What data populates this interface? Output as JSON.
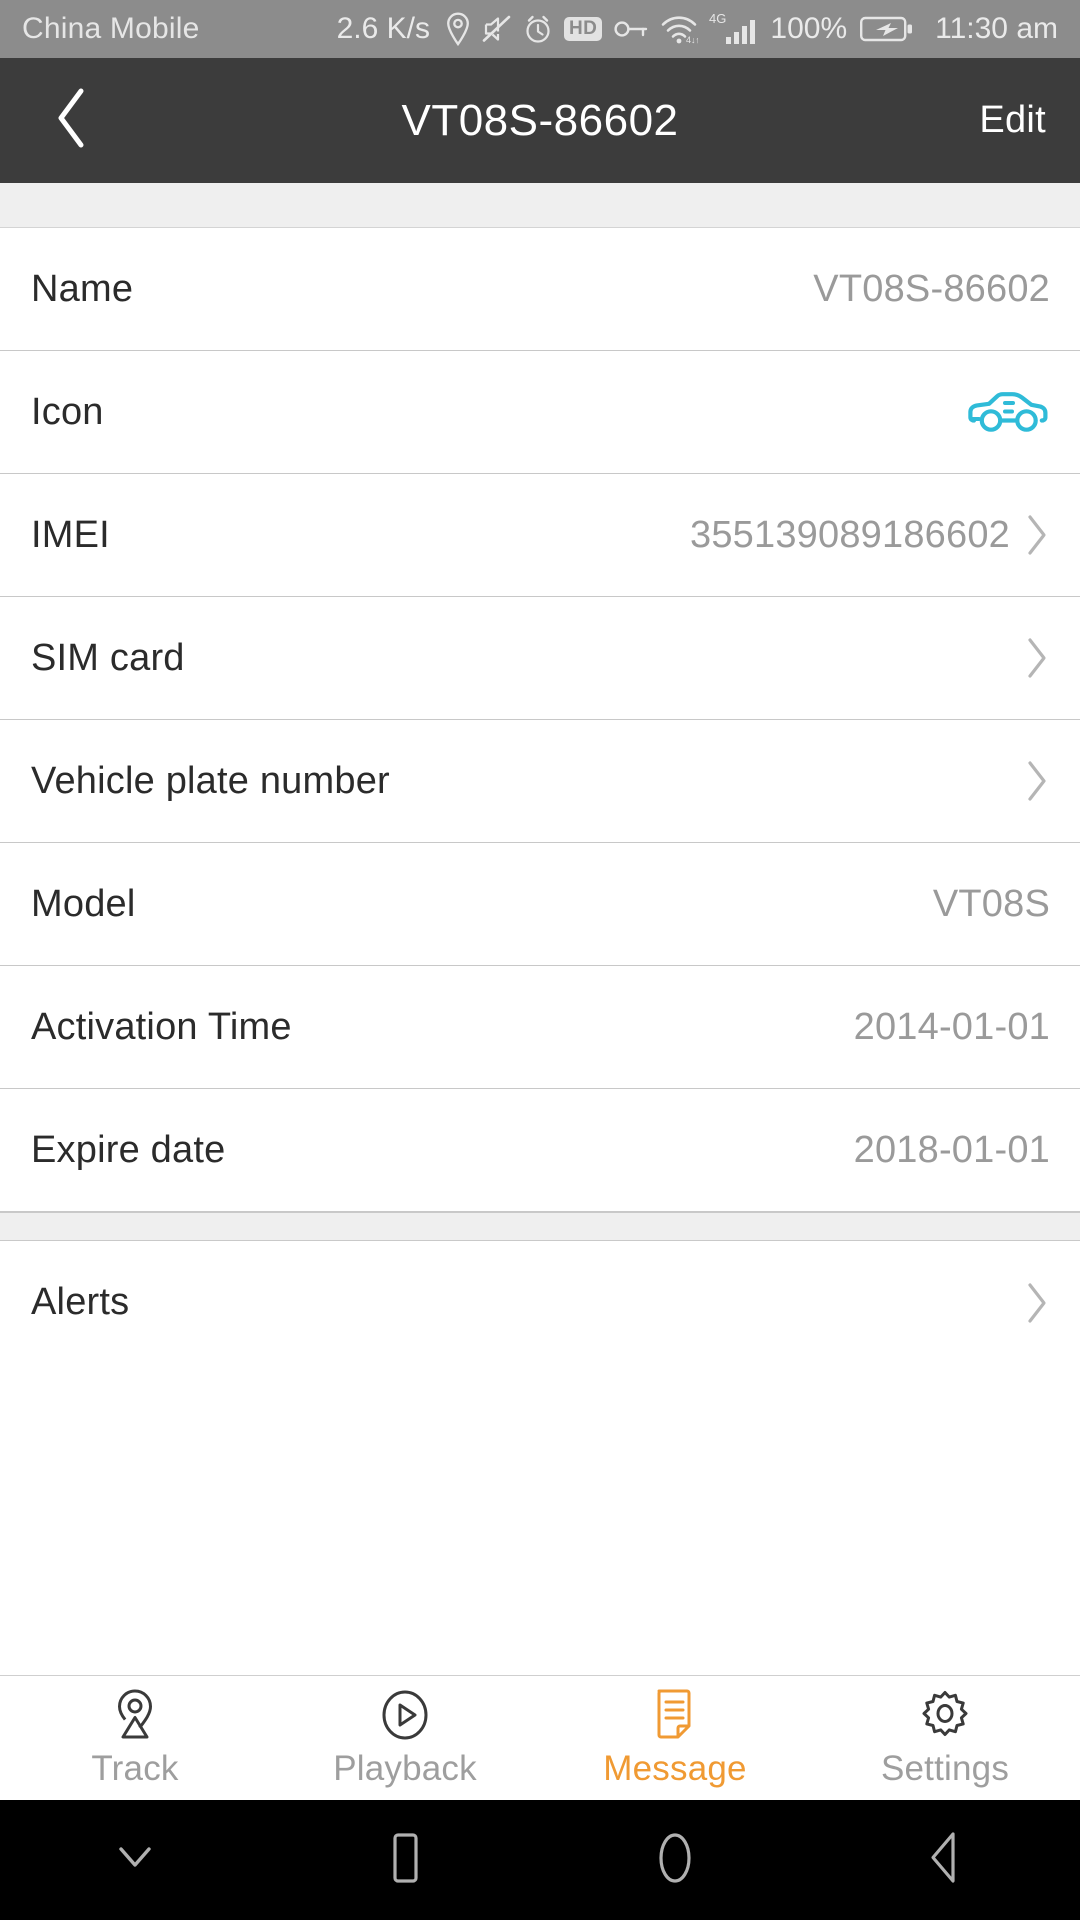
{
  "status_bar": {
    "carrier": "China Mobile",
    "network_speed": "2.6 K/s",
    "battery_percent": "100%",
    "time": "11:30 am",
    "hd_label": "HD",
    "signal_label": "4G",
    "icons": [
      "location-pin-icon",
      "mute-icon",
      "alarm-icon",
      "hd-icon",
      "key-icon",
      "wifi-icon",
      "cellular-signal-icon",
      "battery-charging-icon"
    ]
  },
  "header": {
    "title": "VT08S-86602",
    "back_label": "back-chevron-icon",
    "edit_label": "Edit"
  },
  "details": {
    "rows": [
      {
        "label": "Name",
        "value": "VT08S-86602",
        "chevron": false,
        "icon": ""
      },
      {
        "label": "Icon",
        "value": "",
        "chevron": false,
        "icon": "car-icon"
      },
      {
        "label": "IMEI",
        "value": "355139089186602",
        "chevron": true,
        "icon": ""
      },
      {
        "label": "SIM card",
        "value": "",
        "chevron": true,
        "icon": ""
      },
      {
        "label": "Vehicle plate number",
        "value": "",
        "chevron": true,
        "icon": ""
      },
      {
        "label": "Model",
        "value": "VT08S",
        "chevron": false,
        "icon": ""
      },
      {
        "label": "Activation Time",
        "value": "2014-01-01",
        "chevron": false,
        "icon": ""
      },
      {
        "label": "Expire date",
        "value": "2018-01-01",
        "chevron": false,
        "icon": ""
      }
    ],
    "alerts_rows": [
      {
        "label": "Alerts",
        "value": "",
        "chevron": true,
        "icon": ""
      }
    ]
  },
  "tab_bar": {
    "active_index": 2,
    "active_color": "#f09a33",
    "inactive_color": "#9e9e9e",
    "items": [
      {
        "label": "Track",
        "icon": "location-pin-icon"
      },
      {
        "label": "Playback",
        "icon": "play-circle-icon"
      },
      {
        "label": "Message",
        "icon": "document-icon"
      },
      {
        "label": "Settings",
        "icon": "gear-icon"
      }
    ]
  },
  "nav_bar": {
    "items": [
      {
        "icon": "chevron-down-icon"
      },
      {
        "icon": "recents-square-icon"
      },
      {
        "icon": "home-circle-icon"
      },
      {
        "icon": "back-triangle-icon"
      }
    ]
  },
  "colors": {
    "header_bg": "#3c3c3c",
    "status_bg": "#8c8c8c",
    "accent": "#f09a33",
    "car_icon": "#2fbbd8",
    "value_text": "#9a9a9a",
    "label_text": "#2b2b2b"
  }
}
